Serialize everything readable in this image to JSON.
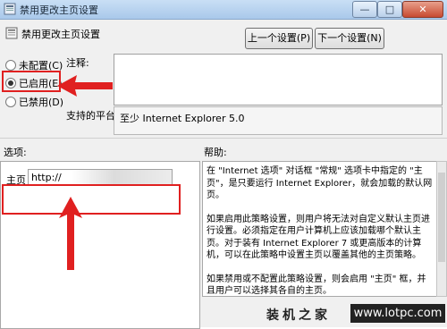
{
  "window": {
    "title": "禁用更改主页设置",
    "min_glyph": "—",
    "max_glyph": "□",
    "close_glyph": "✕"
  },
  "header": {
    "title": "禁用更改主页设置",
    "prev_button": "上一个设置(P)",
    "next_button": "下一个设置(N)"
  },
  "state": {
    "options": [
      {
        "label": "未配置(C)",
        "selected": false
      },
      {
        "label": "已启用(E)",
        "selected": true
      },
      {
        "label": "已禁用(D)",
        "selected": false
      }
    ]
  },
  "comment": {
    "label": "注释:",
    "value": ""
  },
  "platform": {
    "label": "支持的平台:",
    "value": "至少 Internet Explorer 5.0"
  },
  "options_section": {
    "label": "选项:",
    "home_label": "主页",
    "home_value": "http://"
  },
  "help_section": {
    "label": "帮助:",
    "paragraphs": [
      "在 \"Internet 选项\" 对话框 \"常规\" 选项卡中指定的 \"主页\"，是只要运行 Internet Explorer，就会加载的默认网页。",
      "如果启用此策略设置，则用户将无法对自定义默认主页进行设置。必须指定在用户计算机上应该加载哪个默认主页。对于装有 Internet Explorer 7 或更高版本的计算机，可以在此策略中设置主页以覆盖其他的主页策略。",
      "如果禁用或不配置此策略设置，则会启用 \"主页\" 框，并且用户可以选择其各自的主页。"
    ]
  },
  "watermark": {
    "cn": "装机之家",
    "url": "www.lotpc.com"
  },
  "colors": {
    "annotation": "#e02020",
    "titlebar": "#b9d4f0"
  }
}
